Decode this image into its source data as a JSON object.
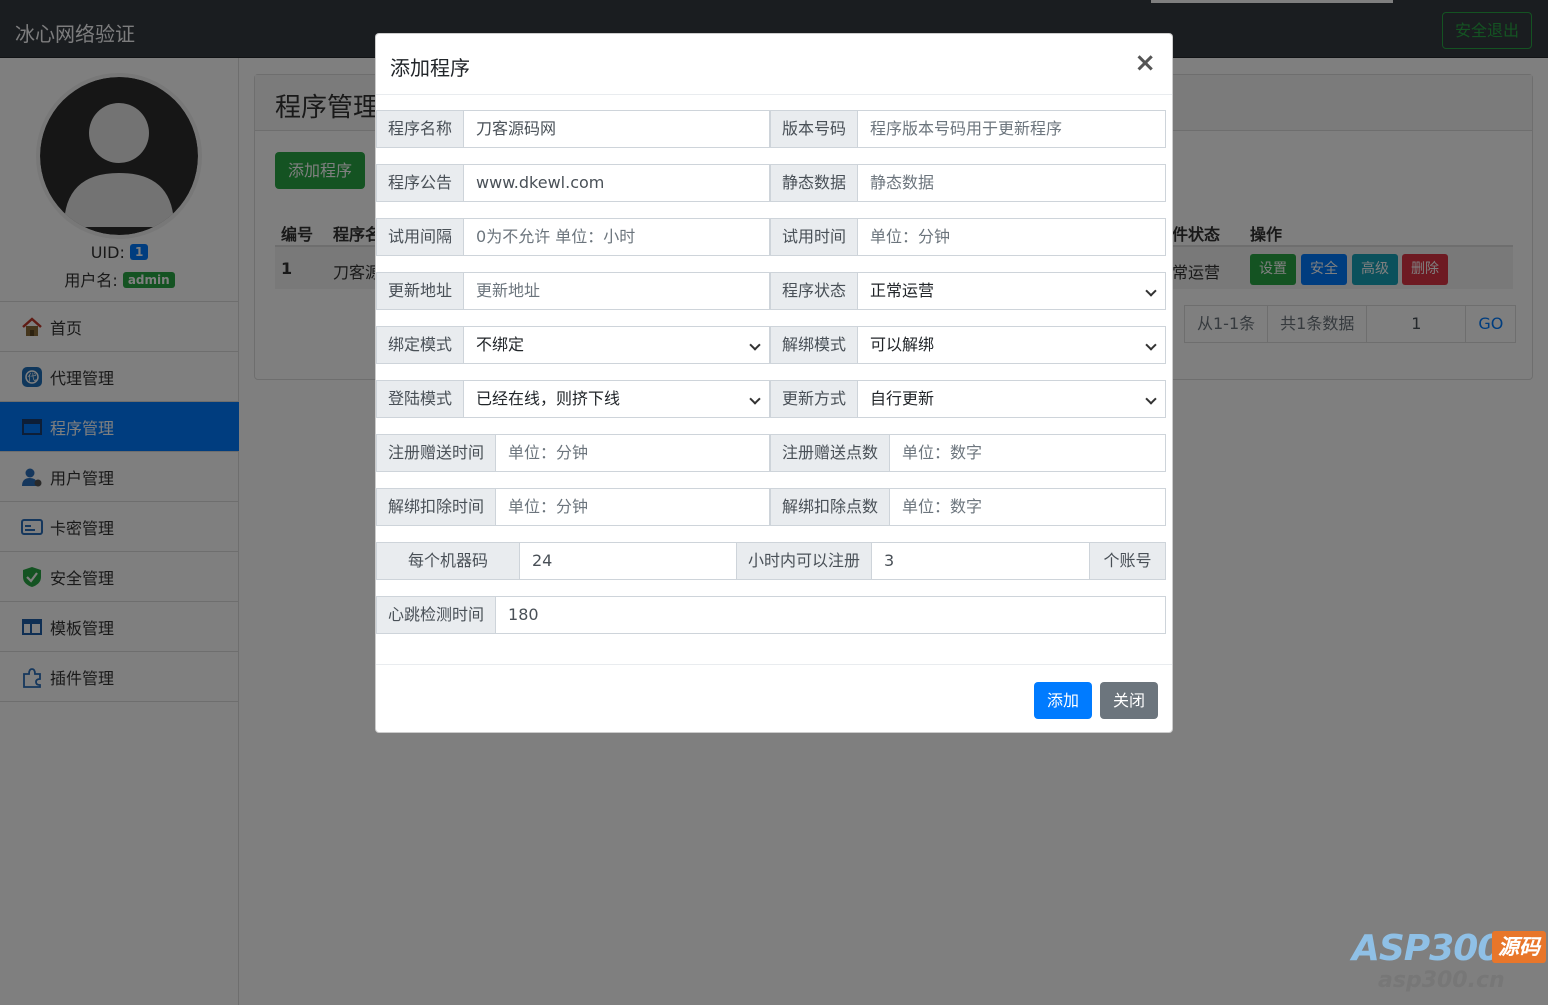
{
  "app": {
    "title": "冰心网络验证",
    "logout": "安全退出"
  },
  "user": {
    "uid_label": "UID:",
    "uid": "1",
    "name_label": "用户名:",
    "name": "admin"
  },
  "sidebar": {
    "items": [
      {
        "label": "首页",
        "icon": "home-icon"
      },
      {
        "label": "代理管理",
        "icon": "agent-icon"
      },
      {
        "label": "程序管理",
        "icon": "program-icon",
        "active": true
      },
      {
        "label": "用户管理",
        "icon": "user-icon"
      },
      {
        "label": "卡密管理",
        "icon": "card-icon"
      },
      {
        "label": "安全管理",
        "icon": "shield-icon"
      },
      {
        "label": "模板管理",
        "icon": "template-icon"
      },
      {
        "label": "插件管理",
        "icon": "plugin-icon"
      }
    ]
  },
  "main": {
    "title": "程序管理",
    "add_button": "添加程序",
    "table": {
      "headers": [
        "编号",
        "程序名",
        "件状态",
        "操作"
      ],
      "rows": [
        {
          "id": "1",
          "name": "刀客源",
          "status": "常运营"
        }
      ],
      "actions": [
        "设置",
        "安全",
        "高级",
        "删除"
      ]
    },
    "pager": {
      "range": "从1-1条",
      "total": "共1条数据",
      "page": "1",
      "go": "GO"
    }
  },
  "modal": {
    "title": "添加程序",
    "close": "×",
    "fields": {
      "name": {
        "label": "程序名称",
        "value": "刀客源码网"
      },
      "version": {
        "label": "版本号码",
        "placeholder": "程序版本号码用于更新程序"
      },
      "notice": {
        "label": "程序公告",
        "value": "www.dkewl.com"
      },
      "static": {
        "label": "静态数据",
        "placeholder": "静态数据"
      },
      "trial_interval": {
        "label": "试用间隔",
        "placeholder": "0为不允许 单位：小时"
      },
      "trial_time": {
        "label": "试用时间",
        "placeholder": "单位：分钟"
      },
      "update_url": {
        "label": "更新地址",
        "placeholder": "更新地址"
      },
      "status": {
        "label": "程序状态",
        "value": "正常运营"
      },
      "bind_mode": {
        "label": "绑定模式",
        "value": "不绑定"
      },
      "unbind_mode": {
        "label": "解绑模式",
        "value": "可以解绑"
      },
      "login_mode": {
        "label": "登陆模式",
        "value": "已经在线，则挤下线"
      },
      "update_mode": {
        "label": "更新方式",
        "value": "自行更新"
      },
      "reg_gift_time": {
        "label": "注册赠送时间",
        "placeholder": "单位：分钟"
      },
      "reg_gift_points": {
        "label": "注册赠送点数",
        "placeholder": "单位：数字"
      },
      "unbind_time": {
        "label": "解绑扣除时间",
        "placeholder": "单位：分钟"
      },
      "unbind_points": {
        "label": "解绑扣除点数",
        "placeholder": "单位：数字"
      },
      "per_machine": {
        "label": "每个机器码",
        "value": "24",
        "mid_label": "小时内可以注册",
        "count": "3",
        "suffix": "个账号"
      },
      "heartbeat": {
        "label": "心跳检测时间",
        "value": "180"
      }
    },
    "buttons": {
      "add": "添加",
      "close": "关闭"
    }
  },
  "watermark": {
    "brand": "ASP300",
    "tag": "源码",
    "url": "asp300.cn"
  },
  "colors": {
    "primary": "#007bff",
    "success": "#28a745",
    "info": "#17a2b8",
    "danger": "#dc3545",
    "secondary": "#6c757d",
    "navbar": "#343a40"
  }
}
